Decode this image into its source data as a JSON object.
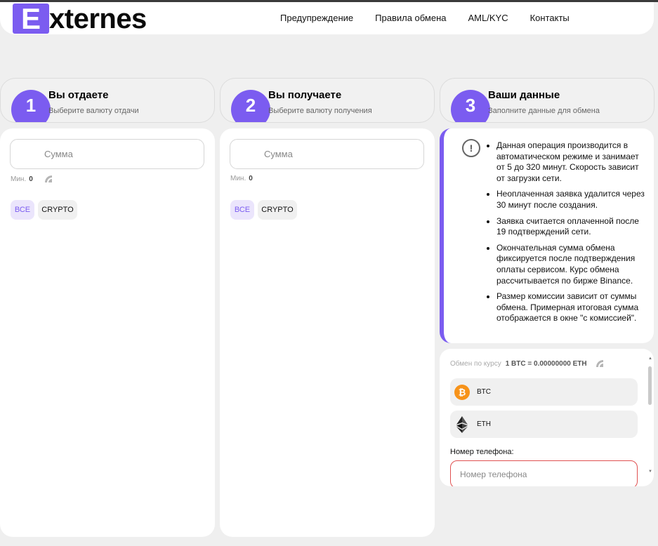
{
  "header": {
    "logo_letter": "E",
    "logo_rest": "xternes",
    "nav": [
      "Предупреждение",
      "Правила обмена",
      "AML/KYC",
      "Контакты"
    ]
  },
  "steps": [
    {
      "number": "1",
      "title": "Вы отдаете",
      "subtitle": "Выберите валюту отдачи"
    },
    {
      "number": "2",
      "title": "Вы получаете",
      "subtitle": "Выберите валюту получения"
    },
    {
      "number": "3",
      "title": "Ваши данные",
      "subtitle": "Заполните данные для обмена"
    }
  ],
  "give": {
    "amount_placeholder": "Сумма",
    "min_label": "Мин.",
    "min_value": "0",
    "filters": [
      "ВСЕ",
      "CRYPTO"
    ]
  },
  "receive": {
    "amount_placeholder": "Сумма",
    "min_label": "Мин.",
    "min_value": "0",
    "filters": [
      "ВСЕ",
      "CRYPTO"
    ]
  },
  "info": {
    "items": [
      "Данная операция производится в автоматическом режиме и занимает от 5 до 320 минут. Скорость зависит от загрузки сети.",
      "Неоплаченная заявка удалится через 30 минут после создания.",
      "Заявка считается оплаченной после 19 подтверждений сети.",
      "Окончательная сумма обмена фиксируется после подтверждения оплаты сервисом. Курс обмена рассчитывается по бирже Binance.",
      "Размер комиссии зависит от суммы обмена. Примерная итоговая сумма отображается в окне \"с комиссией\"."
    ]
  },
  "exchange": {
    "rate_label": "Обмен по курсу",
    "rate_value": "1 BTC = 0.00000000 ETH",
    "from_coin": "BTC",
    "to_coin": "ETH",
    "phone_label": "Номер телефона:",
    "phone_placeholder": "Номер телефона"
  },
  "colors": {
    "accent": "#7b5cf0",
    "btc": "#f7931a",
    "error_border": "#e05050"
  }
}
